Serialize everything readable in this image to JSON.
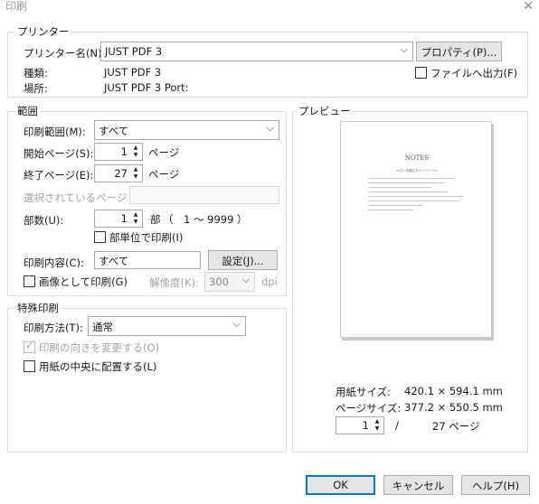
{
  "window": {
    "title": "印刷"
  },
  "printer": {
    "legend": "プリンター",
    "name_label": "プリンター名(N):",
    "name_value": "JUST PDF 3",
    "properties_button": "プロパティ(P)...",
    "type_label": "種類:",
    "type_value": "JUST PDF 3",
    "location_label": "場所:",
    "location_value": "JUST PDF 3 Port:",
    "file_output_label": "ファイルへ出力(F)",
    "file_output_checked": false
  },
  "range": {
    "legend": "範囲",
    "print_range_label": "印刷範囲(M):",
    "print_range_value": "すべて",
    "start_page_label": "開始ページ(S):",
    "start_page_value": "1",
    "start_page_unit": "ページ",
    "end_page_label": "終了ページ(E):",
    "end_page_value": "27",
    "end_page_unit": "ページ",
    "selected_pages_label": "選択されているページ",
    "selected_pages_value": "",
    "copies_label": "部数(U):",
    "copies_value": "1",
    "copies_unit": "部",
    "copies_range": "（　1 〜 9999 ）",
    "collate_label": "部単位で印刷(I)",
    "collate_checked": false,
    "content_label": "印刷内容(C):",
    "content_value": "すべて",
    "settings_button": "設定(J)...",
    "as_image_label": "画像として印刷(G)",
    "as_image_checked": false,
    "resolution_label": "解像度(K):",
    "resolution_value": "300",
    "resolution_unit": "dpi"
  },
  "special": {
    "legend": "特殊印刷",
    "method_label": "印刷方法(T):",
    "method_value": "通常",
    "change_orientation_label": "印刷の向きを変更する(O)",
    "change_orientation_checked": true,
    "center_label": "用紙の中央に配置する(L)",
    "center_checked": false
  },
  "preview": {
    "legend": "プレビュー",
    "doc_title": "NOTES",
    "doc_subtitle": "≪五十音順主なキーワード≫",
    "paper_size_label": "用紙サイズ:",
    "paper_size_value": "420.1 × 594.1 mm",
    "page_size_label": "ページサイズ:",
    "page_size_value": "377.2 × 550.5 mm",
    "current_page": "1",
    "page_separator": "/",
    "total_pages": "27 ページ"
  },
  "buttons": {
    "ok": "OK",
    "cancel": "キャンセル",
    "help": "ヘルプ(H)"
  },
  "colors": {
    "accent": "#0078d7",
    "button_bg": "#e5e5e5",
    "border": "#dcdcdc",
    "disabled_text": "#a3a3a3"
  }
}
